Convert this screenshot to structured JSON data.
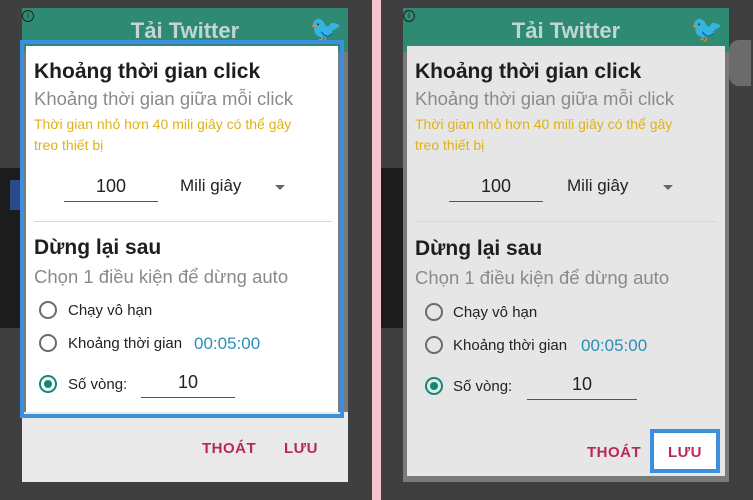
{
  "app": {
    "title": "Tải Twitter"
  },
  "dialog": {
    "interval_title": "Khoảng thời gian click",
    "interval_subtitle": "Khoảng thời gian giữa mỗi click",
    "warning_line1": "Thời gian nhỏ hơn 40 mili giây có thể gây",
    "warning_line2": "treo thiết bị",
    "interval_value": "100",
    "unit_selected": "Mili giây",
    "stop_title": "Dừng lại sau",
    "stop_subtitle": "Chọn 1 điều kiện để dừng auto",
    "options": [
      {
        "label": "Chạy vô hạn",
        "checked": false
      },
      {
        "label": "Khoảng thời gian",
        "checked": false
      },
      {
        "label": "Số vòng:",
        "checked": true
      }
    ],
    "time_value": "00:05:00",
    "loops_value": "10",
    "cancel_label": "THOÁT",
    "save_label": "LƯU"
  },
  "colors": {
    "accent_highlight": "#3b8ee0",
    "button_text": "#b8265a",
    "radio_checked": "#0f8a72",
    "warning": "#e0b118",
    "time": "#2b8fb5"
  }
}
